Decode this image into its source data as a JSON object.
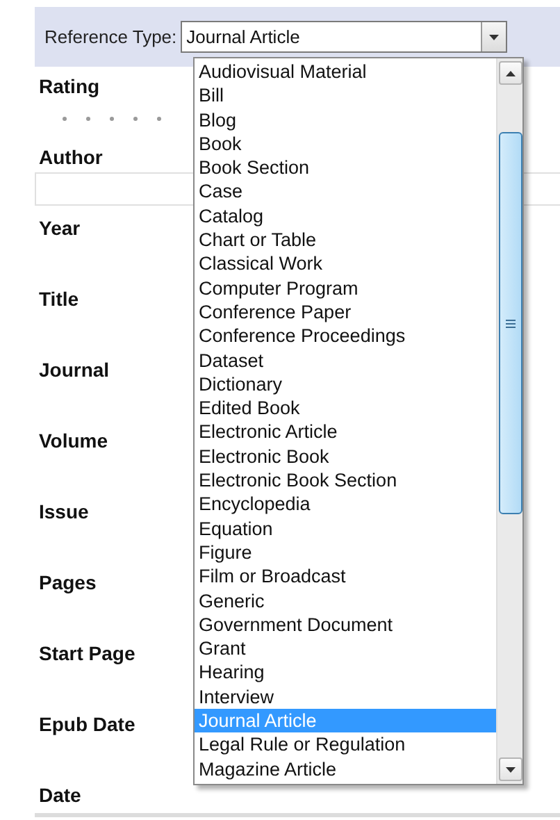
{
  "reference_type": {
    "label": "Reference Type:",
    "value": "Journal Article",
    "expanded": true
  },
  "options": [
    {
      "label": "Audiovisual Material",
      "selected": false
    },
    {
      "label": "Bill",
      "selected": false
    },
    {
      "label": "Blog",
      "selected": false
    },
    {
      "label": "Book",
      "selected": false
    },
    {
      "label": "Book Section",
      "selected": false
    },
    {
      "label": "Case",
      "selected": false
    },
    {
      "label": "Catalog",
      "selected": false
    },
    {
      "label": "Chart or Table",
      "selected": false
    },
    {
      "label": "Classical Work",
      "selected": false
    },
    {
      "label": "Computer Program",
      "selected": false
    },
    {
      "label": "Conference Paper",
      "selected": false
    },
    {
      "label": "Conference Proceedings",
      "selected": false
    },
    {
      "label": "Dataset",
      "selected": false
    },
    {
      "label": "Dictionary",
      "selected": false
    },
    {
      "label": "Edited Book",
      "selected": false
    },
    {
      "label": "Electronic Article",
      "selected": false
    },
    {
      "label": "Electronic Book",
      "selected": false
    },
    {
      "label": "Electronic Book Section",
      "selected": false
    },
    {
      "label": "Encyclopedia",
      "selected": false
    },
    {
      "label": "Equation",
      "selected": false
    },
    {
      "label": "Figure",
      "selected": false
    },
    {
      "label": "Film or Broadcast",
      "selected": false
    },
    {
      "label": "Generic",
      "selected": false
    },
    {
      "label": "Government Document",
      "selected": false
    },
    {
      "label": "Grant",
      "selected": false
    },
    {
      "label": "Hearing",
      "selected": false
    },
    {
      "label": "Interview",
      "selected": false
    },
    {
      "label": "Journal Article",
      "selected": true
    },
    {
      "label": "Legal Rule or Regulation",
      "selected": false
    },
    {
      "label": "Magazine Article",
      "selected": false
    }
  ],
  "fields": [
    {
      "label": "Rating",
      "kind": "rating"
    },
    {
      "label": "Author",
      "kind": "field"
    },
    {
      "label": "Year",
      "kind": "plain"
    },
    {
      "label": "Title",
      "kind": "plain"
    },
    {
      "label": "Journal",
      "kind": "plain"
    },
    {
      "label": "Volume",
      "kind": "plain"
    },
    {
      "label": "Issue",
      "kind": "plain"
    },
    {
      "label": "Pages",
      "kind": "plain"
    },
    {
      "label": "Start Page",
      "kind": "plain"
    },
    {
      "label": "Epub Date",
      "kind": "plain"
    },
    {
      "label": "Date",
      "kind": "plain"
    }
  ]
}
